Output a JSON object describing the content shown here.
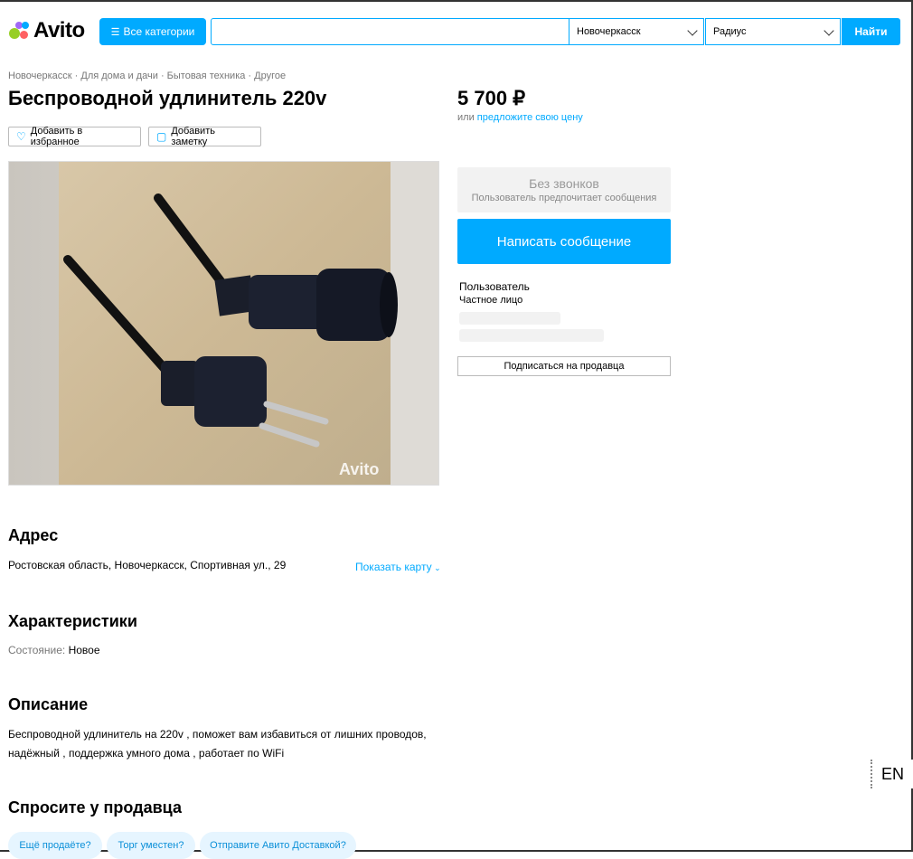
{
  "header": {
    "logo_text": "Avito",
    "categories_label": "Все категории",
    "search_value": "",
    "city": "Новочеркасск",
    "radius": "Радиус",
    "find_label": "Найти"
  },
  "breadcrumb": "Новочеркасск · Для дома и дачи · Бытовая техника · Другое",
  "item": {
    "title": "Беспроводной удлинитель 220v",
    "price": "5 700 ₽",
    "offer_prefix": "или",
    "offer_link": "предложите свою цену"
  },
  "actions": {
    "favorite": "Добавить в избранное",
    "note": "Добавить заметку"
  },
  "photo": {
    "watermark": "Avito"
  },
  "seller": {
    "no_calls": "Без звонков",
    "no_calls_sub": "Пользователь предпочитает сообщения",
    "message_btn": "Написать сообщение",
    "name": "Пользователь",
    "type": "Частное лицо",
    "subscribe": "Подписаться на продавца"
  },
  "address": {
    "heading": "Адрес",
    "value": "Ростовская область, Новочеркасск, Спортивная ул., 29",
    "map_link": "Показать карту"
  },
  "specs": {
    "heading": "Характеристики",
    "label": "Состояние:",
    "value": "Новое"
  },
  "description": {
    "heading": "Описание",
    "line1": "Беспроводной удлинитель на 220v , поможет вам избавиться от лишних проводов,",
    "line2": "надёжный , поддержка умного дома , работает по WiFi"
  },
  "ask": {
    "heading": "Спросите у продавца",
    "chips": [
      "Ещё продаёте?",
      "Торг уместен?",
      "Отправите Авито Доставкой?"
    ]
  },
  "lang": "EN",
  "colors": {
    "accent": "#00aaff",
    "logo_green": "#97cf26",
    "logo_blue": "#0af",
    "logo_red": "#ff6163",
    "logo_purple": "#a169f7"
  }
}
